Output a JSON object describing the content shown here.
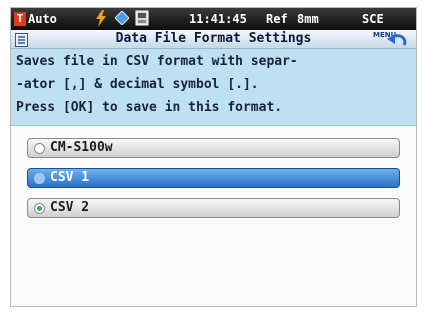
{
  "status_bar": {
    "mode": "Auto",
    "time": "11:41:45",
    "reference": "Ref",
    "area": "8mm",
    "geometry": "SCE"
  },
  "header": {
    "title": "Data File Format Settings",
    "menu_label": "MENU"
  },
  "message": {
    "line1": "Saves file in CSV format with separ-",
    "line2": "-ator [,] & decimal symbol [.].",
    "line3": "Press [OK] to save in this format."
  },
  "options": [
    {
      "label": "CM-S100w",
      "highlighted": false,
      "checked": false
    },
    {
      "label": "CSV 1",
      "highlighted": true,
      "checked": false
    },
    {
      "label": "CSV 2",
      "highlighted": false,
      "checked": true
    }
  ],
  "colors": {
    "status_bar_bg": "#1a1a1a",
    "message_bg": "#bfe0f1",
    "selected_option": "#3a86d8",
    "radio_checked": "#2bb14a",
    "mode_badge": "#e03a1a"
  }
}
